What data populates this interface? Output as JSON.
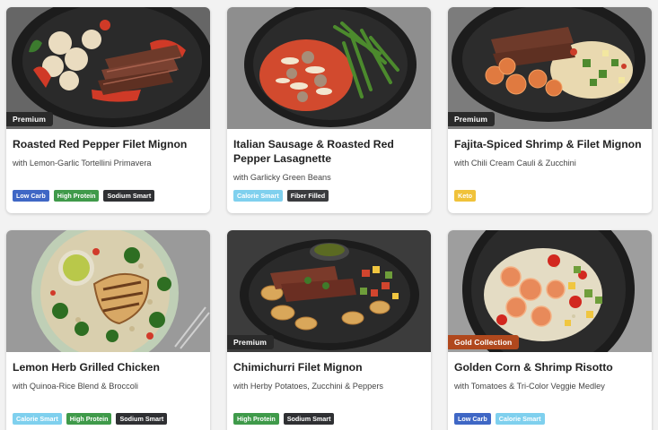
{
  "meals": [
    {
      "title": "Roasted Red Pepper Filet Mignon",
      "subtitle": "with Lemon-Garlic Tortellini Primavera",
      "badge": "Premium",
      "tags": [
        "Low Carb",
        "High Protein",
        "Sodium Smart"
      ]
    },
    {
      "title": "Italian Sausage & Roasted Red Pepper Lasagnette",
      "subtitle": "with Garlicky Green Beans",
      "badge": "",
      "tags": [
        "Calorie Smart",
        "Fiber Filled"
      ]
    },
    {
      "title": "Fajita-Spiced Shrimp & Filet Mignon",
      "subtitle": "with Chili Cream Cauli & Zucchini",
      "badge": "Premium",
      "tags": [
        "Keto"
      ]
    },
    {
      "title": "Lemon Herb Grilled Chicken",
      "subtitle": "with Quinoa-Rice Blend & Broccoli",
      "badge": "",
      "tags": [
        "Calorie Smart",
        "High Protein",
        "Sodium Smart"
      ]
    },
    {
      "title": "Chimichurri Filet Mignon",
      "subtitle": "with Herby Potatoes, Zucchini & Peppers",
      "badge": "Premium",
      "tags": [
        "High Protein",
        "Sodium Smart"
      ]
    },
    {
      "title": "Golden Corn & Shrimp Risotto",
      "subtitle": "with Tomatoes & Tri-Color Veggie Medley",
      "badge": "Gold Collection",
      "tags": [
        "Low Carb",
        "Calorie Smart"
      ]
    }
  ],
  "colors": {
    "premium_badge": "#2a2a2a",
    "gold_badge": "#b0481d",
    "low_carb": "#3f67c5",
    "high_protein": "#3f9a4a",
    "sodium_smart": "#2f3033",
    "calorie_smart": "#7fd0ee",
    "fiber_filled": "#3a3b3e",
    "keto": "#f0c23a"
  }
}
